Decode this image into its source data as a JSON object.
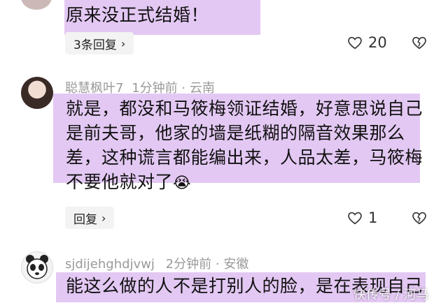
{
  "comments": [
    {
      "text": "原来没正式结婚！",
      "reply_label": "3条回复",
      "likes": "20"
    },
    {
      "username": "聪慧枫叶7",
      "time": "1分钟前",
      "location": "云南",
      "text_lines": [
        "就是，都没和马筱梅领证结婚，好意思说自己",
        "是前夫哥，他家的墙是纸糊的隔音效果那么",
        "差，这种谎言都能编出来，人品太差，马筱梅",
        "不要他就对了"
      ],
      "emoji": "😭",
      "reply_label": "回复",
      "likes": "1"
    },
    {
      "username": "sjdijehghdjvwj",
      "time": "2分钟前",
      "location": "安徽",
      "text": "能这么做的人不是打别人的脸，是在表现自己"
    }
  ],
  "separator": "·",
  "watermark": "快传号 / 河马",
  "icons": {
    "like": "heart-icon",
    "dislike": "broken-heart-icon",
    "chevron": "chevron-right-icon"
  },
  "colors": {
    "highlight": "#e3c8f3",
    "meta_text": "#9a9a9a"
  }
}
